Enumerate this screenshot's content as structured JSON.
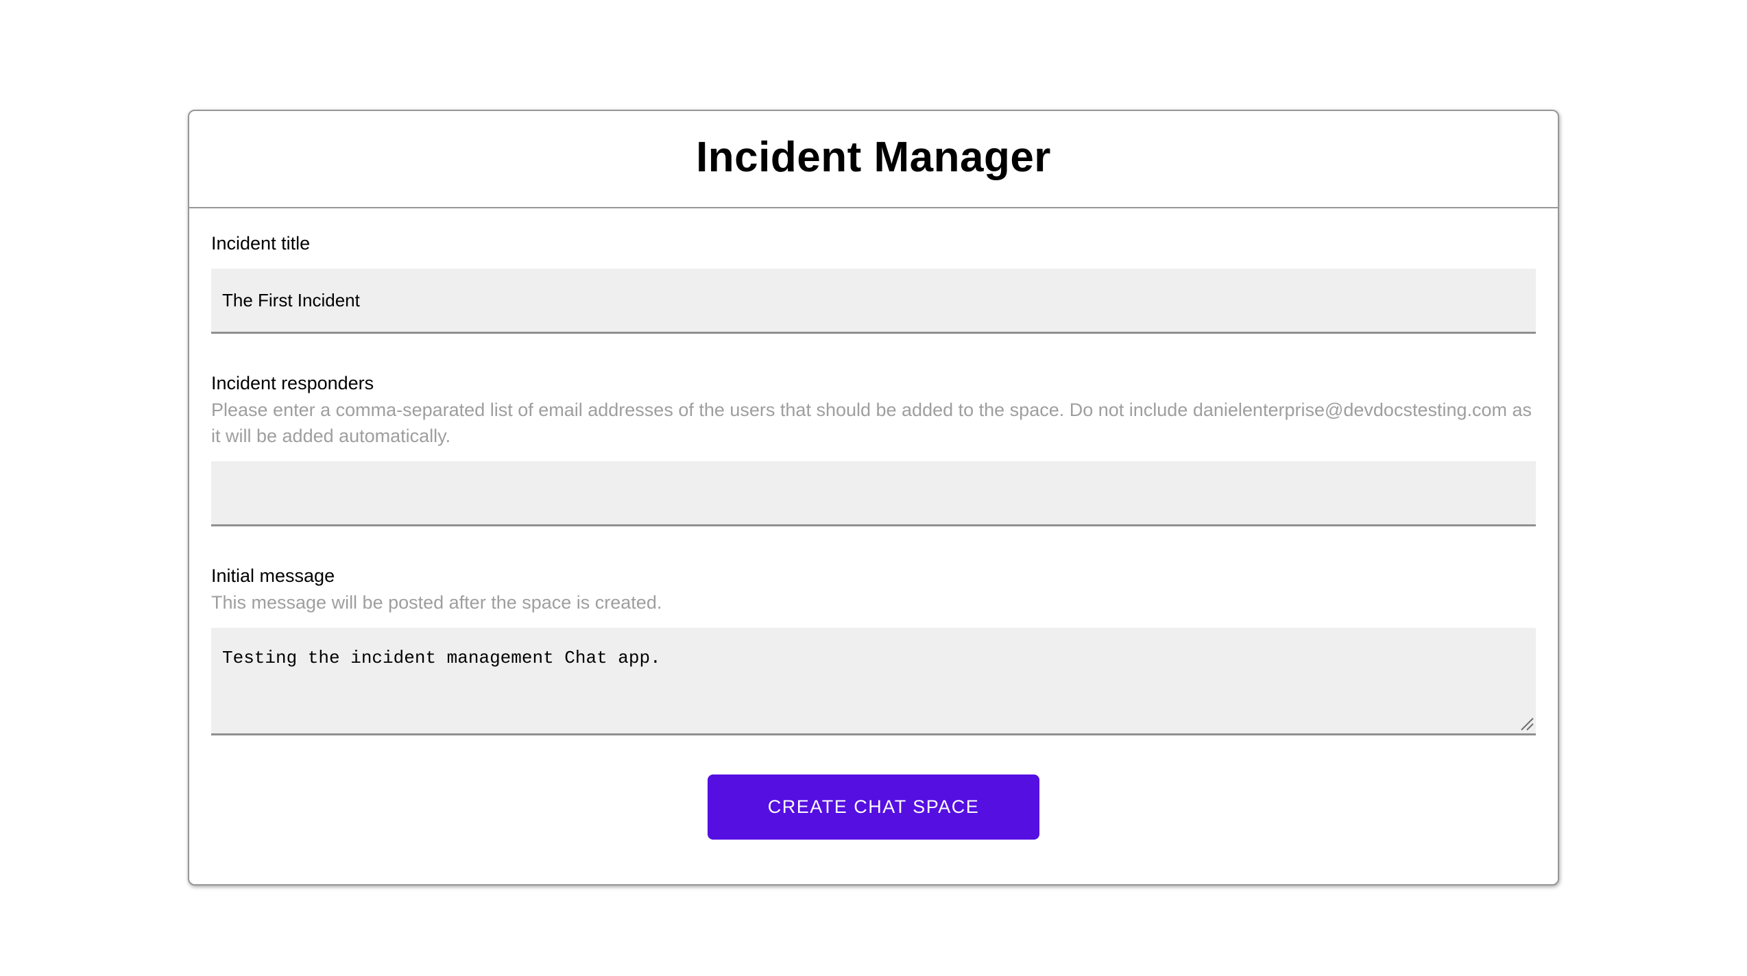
{
  "app": {
    "title": "Incident Manager"
  },
  "form": {
    "incident_title": {
      "label": "Incident title",
      "value": "The First Incident"
    },
    "incident_responders": {
      "label": "Incident responders",
      "helper": "Please enter a comma-separated list of email addresses of the users that should be added to the space. Do not include danielenterprise@devdocstesting.com as it will be added automatically.",
      "value": ""
    },
    "initial_message": {
      "label": "Initial message",
      "helper": "This message will be posted after the space is created.",
      "value": "Testing the incident management Chat app."
    },
    "submit_label": "CREATE CHAT SPACE"
  },
  "colors": {
    "accent": "#550fe1",
    "input_background": "#efefef",
    "input_border_bottom": "#8f8f8f",
    "helper_text": "#9e9e9e",
    "card_border": "#979797"
  }
}
